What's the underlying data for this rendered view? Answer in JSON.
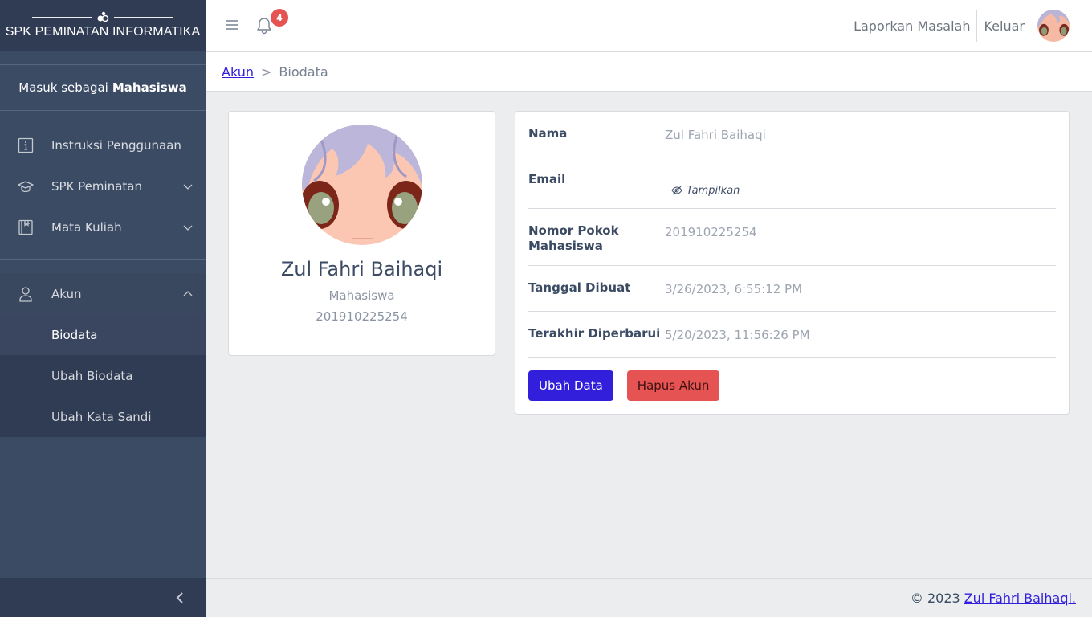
{
  "brand": {
    "title": "SPK PEMINATAN INFORMATIKA"
  },
  "sidebar": {
    "login_prefix": "Masuk sebagai",
    "login_role": "Mahasiswa",
    "items": [
      {
        "label": "Instruksi Penggunaan",
        "icon": "info-icon"
      },
      {
        "label": "SPK Peminatan",
        "icon": "graduation-cap-icon"
      },
      {
        "label": "Mata Kuliah",
        "icon": "book-icon"
      }
    ],
    "account": {
      "label": "Akun",
      "icon": "user-icon",
      "children": [
        {
          "label": "Biodata",
          "active": true
        },
        {
          "label": "Ubah Biodata",
          "active": false
        },
        {
          "label": "Ubah Kata Sandi",
          "active": false
        }
      ]
    }
  },
  "header": {
    "notification_count": "4",
    "report_label": "Laporkan Masalah",
    "logout_label": "Keluar"
  },
  "breadcrumb": {
    "parent": "Akun",
    "separator": ">",
    "current": "Biodata"
  },
  "profile": {
    "name": "Zul Fahri Baihaqi",
    "role": "Mahasiswa",
    "nim": "201910225254"
  },
  "details": {
    "name_label": "Nama",
    "name_value": "Zul Fahri Baihaqi",
    "email_label": "Email",
    "email_toggle": "Tampilkan",
    "nim_label": "Nomor Pokok Mahasiswa",
    "nim_value": "201910225254",
    "created_label": "Tanggal Dibuat",
    "created_value": "3/26/2023, 6:55:12 PM",
    "updated_label": "Terakhir Diperbarui",
    "updated_value": "5/20/2023, 11:56:26 PM"
  },
  "actions": {
    "edit_label": "Ubah Data",
    "delete_label": "Hapus Akun"
  },
  "footer": {
    "copyright": "© 2023",
    "author": "Zul Fahri Baihaqi."
  },
  "colors": {
    "sidebar": "#3c4b64",
    "primary": "#321fdb",
    "danger": "#e55353"
  }
}
